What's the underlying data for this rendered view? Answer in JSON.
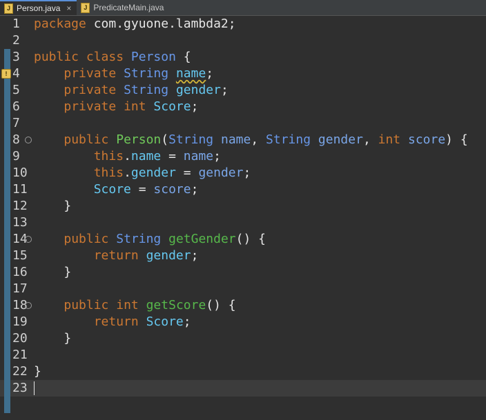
{
  "tabs": [
    {
      "label": "Person.java",
      "active": true,
      "icon": "java-file-icon",
      "close": "×"
    },
    {
      "label": "PredicateMain.java",
      "active": false,
      "icon": "java-file-icon"
    }
  ],
  "editor": {
    "current_line": 23,
    "lines": [
      {
        "n": "1",
        "tokens": [
          [
            "kw",
            "package"
          ],
          [
            "pl",
            " com.gyuone.lambda2;"
          ]
        ]
      },
      {
        "n": "2",
        "tokens": []
      },
      {
        "n": "3",
        "tokens": [
          [
            "kw",
            "public"
          ],
          [
            "pl",
            " "
          ],
          [
            "kw",
            "class"
          ],
          [
            "pl",
            " "
          ],
          [
            "ty",
            "Person"
          ],
          [
            "pl",
            " {"
          ]
        ]
      },
      {
        "n": "4",
        "marker": "warning-icon",
        "tokens": [
          [
            "pl",
            "    "
          ],
          [
            "kw",
            "private"
          ],
          [
            "pl",
            " "
          ],
          [
            "ty",
            "String"
          ],
          [
            "pl",
            " "
          ],
          [
            "fld squig",
            "name"
          ],
          [
            "pl",
            ";"
          ]
        ]
      },
      {
        "n": "5",
        "tokens": [
          [
            "pl",
            "    "
          ],
          [
            "kw",
            "private"
          ],
          [
            "pl",
            " "
          ],
          [
            "ty",
            "String"
          ],
          [
            "pl",
            " "
          ],
          [
            "fld",
            "gender"
          ],
          [
            "pl",
            ";"
          ]
        ]
      },
      {
        "n": "6",
        "tokens": [
          [
            "pl",
            "    "
          ],
          [
            "kw",
            "private"
          ],
          [
            "pl",
            " "
          ],
          [
            "kw",
            "int"
          ],
          [
            "pl",
            " "
          ],
          [
            "fld",
            "Score"
          ],
          [
            "pl",
            ";"
          ]
        ]
      },
      {
        "n": "7",
        "tokens": []
      },
      {
        "n": "8",
        "fold": "⊖",
        "tokens": [
          [
            "pl",
            "    "
          ],
          [
            "kw",
            "public"
          ],
          [
            "pl",
            " "
          ],
          [
            "ctor",
            "Person"
          ],
          [
            "pl",
            "("
          ],
          [
            "ty",
            "String"
          ],
          [
            "pl",
            " "
          ],
          [
            "prm",
            "name"
          ],
          [
            "pl",
            ", "
          ],
          [
            "ty",
            "String"
          ],
          [
            "pl",
            " "
          ],
          [
            "prm",
            "gender"
          ],
          [
            "pl",
            ", "
          ],
          [
            "kw",
            "int"
          ],
          [
            "pl",
            " "
          ],
          [
            "prm",
            "score"
          ],
          [
            "pl",
            ") {"
          ]
        ]
      },
      {
        "n": "9",
        "tokens": [
          [
            "pl",
            "        "
          ],
          [
            "kw",
            "this"
          ],
          [
            "pl",
            "."
          ],
          [
            "fld",
            "name"
          ],
          [
            "pl",
            " = "
          ],
          [
            "prm",
            "name"
          ],
          [
            "pl",
            ";"
          ]
        ]
      },
      {
        "n": "10",
        "tokens": [
          [
            "pl",
            "        "
          ],
          [
            "kw",
            "this"
          ],
          [
            "pl",
            "."
          ],
          [
            "fld",
            "gender"
          ],
          [
            "pl",
            " = "
          ],
          [
            "prm",
            "gender"
          ],
          [
            "pl",
            ";"
          ]
        ]
      },
      {
        "n": "11",
        "tokens": [
          [
            "pl",
            "        "
          ],
          [
            "fld",
            "Score"
          ],
          [
            "pl",
            " = "
          ],
          [
            "prm",
            "score"
          ],
          [
            "pl",
            ";"
          ]
        ]
      },
      {
        "n": "12",
        "tokens": [
          [
            "pl",
            "    }"
          ]
        ]
      },
      {
        "n": "13",
        "tokens": []
      },
      {
        "n": "14",
        "fold": "⊖",
        "tokens": [
          [
            "pl",
            "    "
          ],
          [
            "kw",
            "public"
          ],
          [
            "pl",
            " "
          ],
          [
            "ty",
            "String"
          ],
          [
            "pl",
            " "
          ],
          [
            "mth",
            "getGender"
          ],
          [
            "pl",
            "() {"
          ]
        ]
      },
      {
        "n": "15",
        "tokens": [
          [
            "pl",
            "        "
          ],
          [
            "kw",
            "return"
          ],
          [
            "pl",
            " "
          ],
          [
            "fld",
            "gender"
          ],
          [
            "pl",
            ";"
          ]
        ]
      },
      {
        "n": "16",
        "tokens": [
          [
            "pl",
            "    }"
          ]
        ]
      },
      {
        "n": "17",
        "tokens": []
      },
      {
        "n": "18",
        "fold": "⊖",
        "tokens": [
          [
            "pl",
            "    "
          ],
          [
            "kw",
            "public"
          ],
          [
            "pl",
            " "
          ],
          [
            "kw",
            "int"
          ],
          [
            "pl",
            " "
          ],
          [
            "mth",
            "getScore"
          ],
          [
            "pl",
            "() {"
          ]
        ]
      },
      {
        "n": "19",
        "tokens": [
          [
            "pl",
            "        "
          ],
          [
            "kw",
            "return"
          ],
          [
            "pl",
            " "
          ],
          [
            "fld",
            "Score"
          ],
          [
            "pl",
            ";"
          ]
        ]
      },
      {
        "n": "20",
        "tokens": [
          [
            "pl",
            "    }"
          ]
        ]
      },
      {
        "n": "21",
        "tokens": []
      },
      {
        "n": "22",
        "tokens": [
          [
            "pl",
            "}"
          ]
        ]
      },
      {
        "n": "23",
        "tokens": []
      }
    ]
  }
}
